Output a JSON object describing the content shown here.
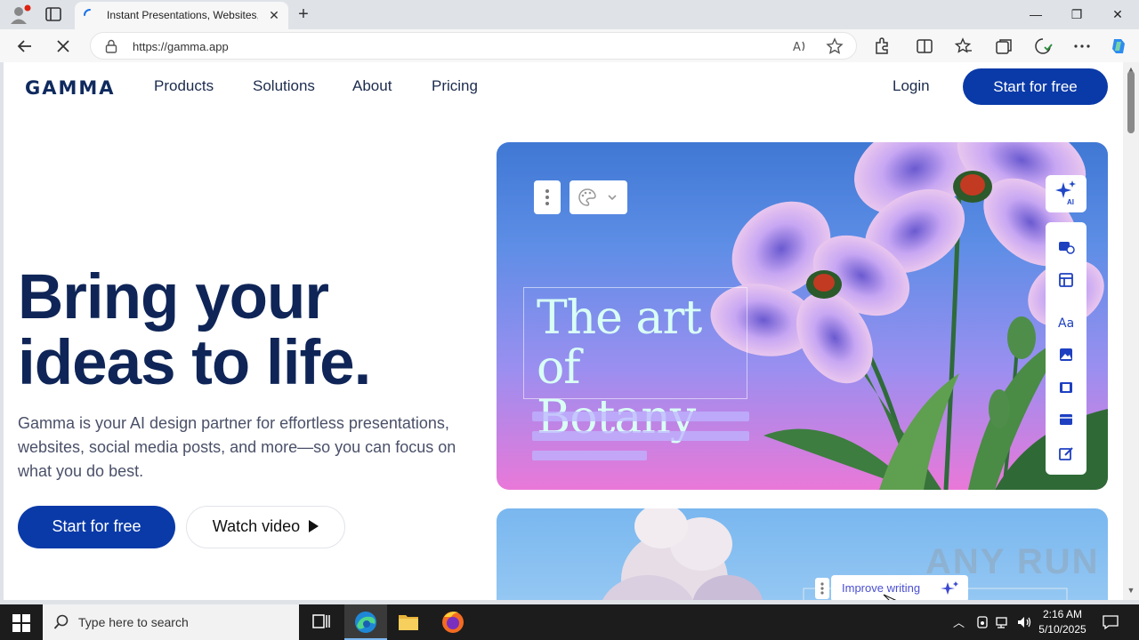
{
  "browser": {
    "tab_title": "Instant Presentations, Websites, a",
    "url": "https://gamma.app",
    "close_tab": "✕",
    "new_tab": "+",
    "minimize": "—",
    "restore": "❐",
    "close_window": "✕"
  },
  "site": {
    "logo": "GAMMA",
    "nav": [
      "Products",
      "Solutions",
      "About",
      "Pricing"
    ],
    "login": "Login",
    "start_top": "Start for free",
    "headline_line1": "Bring your",
    "headline_line2": "ideas to life.",
    "subtext": "Gamma is your AI design partner for effortless presentations, websites, social media posts, and more—so you can focus on what you do best.",
    "cta_primary": "Start for free",
    "cta_secondary": "Watch video",
    "card_title_line1": "The art",
    "card_title_line2": "of Botany",
    "ai_badge": "AI",
    "improve_writing": "Improve writing"
  },
  "watermark": "ANY RUN",
  "taskbar": {
    "search_placeholder": "Type here to search",
    "time": "2:16 AM",
    "date": "5/10/2025"
  },
  "colors": {
    "brand_navy": "#0f2557",
    "button_blue": "#0a3aa8"
  }
}
